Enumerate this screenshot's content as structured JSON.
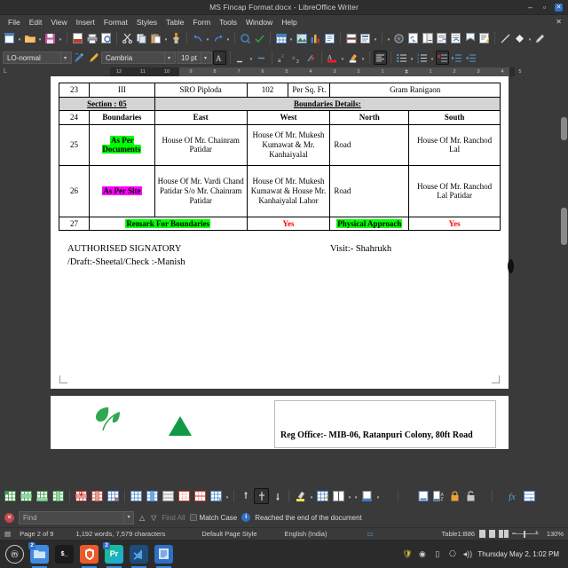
{
  "window": {
    "title": "MS Fincap Format.docx - LibreOffice Writer",
    "minimize": "–",
    "maximize": "▫",
    "close": "✕"
  },
  "menubar": {
    "items": [
      {
        "label": "File"
      },
      {
        "label": "Edit"
      },
      {
        "label": "View"
      },
      {
        "label": "Insert"
      },
      {
        "label": "Format"
      },
      {
        "label": "Styles"
      },
      {
        "label": "Table"
      },
      {
        "label": "Form"
      },
      {
        "label": "Tools"
      },
      {
        "label": "Window"
      },
      {
        "label": "Help"
      }
    ],
    "doc_close": "✕"
  },
  "standard_toolbar": {
    "items": [
      {
        "name": "new-icon",
        "glyph": "new"
      },
      {
        "name": "open-icon",
        "glyph": "open"
      },
      {
        "name": "save-icon",
        "glyph": "save"
      },
      {
        "name": "export-pdf-icon",
        "glyph": "pdf"
      },
      {
        "name": "print-icon",
        "glyph": "print"
      },
      {
        "name": "print-preview-icon",
        "glyph": "preview"
      },
      {
        "name": "cut-icon",
        "glyph": "cut"
      },
      {
        "name": "copy-icon",
        "glyph": "copy"
      },
      {
        "name": "paste-icon",
        "glyph": "paste"
      },
      {
        "name": "clone-formatting-icon",
        "glyph": "clone"
      },
      {
        "name": "undo-icon",
        "glyph": "undo"
      },
      {
        "name": "redo-icon",
        "glyph": "redo"
      },
      {
        "name": "find-replace-icon",
        "glyph": "find"
      },
      {
        "name": "spelling-icon",
        "glyph": "spell"
      },
      {
        "name": "insert-table-icon",
        "glyph": "table"
      },
      {
        "name": "insert-image-icon",
        "glyph": "image"
      },
      {
        "name": "insert-chart-icon",
        "glyph": "chart"
      },
      {
        "name": "insert-textbox-icon",
        "glyph": "textbox"
      },
      {
        "name": "page-break-icon",
        "glyph": "pagebreak"
      },
      {
        "name": "insert-field-icon",
        "glyph": "field"
      },
      {
        "name": "insert-special-character-icon",
        "glyph": "specialchar"
      },
      {
        "name": "insert-hyperlink-icon",
        "glyph": "link"
      },
      {
        "name": "insert-footnote-icon",
        "glyph": "footnote"
      },
      {
        "name": "insert-endnote-icon",
        "glyph": "endnote"
      },
      {
        "name": "bookmark-icon",
        "glyph": "bookmark"
      },
      {
        "name": "cross-reference-icon",
        "glyph": "xref"
      },
      {
        "name": "comment-icon",
        "glyph": "comment"
      },
      {
        "name": "track-changes-icon",
        "glyph": "track"
      },
      {
        "name": "line-icon",
        "glyph": "line"
      },
      {
        "name": "basic-shapes-icon",
        "glyph": "shapes"
      },
      {
        "name": "show-draw-functions-icon",
        "glyph": "draw"
      }
    ]
  },
  "formatting_toolbar": {
    "paragraph_style": "LO-normal",
    "font_name": "Cambria",
    "font_size": "10 pt",
    "dropdown_arrow": "▾",
    "items": [
      {
        "name": "update-style-icon"
      },
      {
        "name": "new-style-icon"
      },
      {
        "name": "bold-icon"
      },
      {
        "name": "italic-icon"
      },
      {
        "name": "underline-icon"
      },
      {
        "name": "strikethrough-icon"
      },
      {
        "name": "superscript-icon"
      },
      {
        "name": "subscript-icon"
      },
      {
        "name": "clear-formatting-icon"
      },
      {
        "name": "font-color-icon"
      },
      {
        "name": "highlight-color-icon"
      },
      {
        "name": "align-left-icon"
      },
      {
        "name": "align-center-icon"
      },
      {
        "name": "align-right-icon"
      },
      {
        "name": "justified-icon"
      },
      {
        "name": "unordered-list-icon"
      },
      {
        "name": "ordered-list-icon"
      },
      {
        "name": "no-list-icon"
      },
      {
        "name": "increase-indent-icon"
      },
      {
        "name": "decrease-indent-icon"
      }
    ]
  },
  "ruler": {
    "ticks": [
      "12",
      "11",
      "10",
      "9",
      "8",
      "7",
      "6",
      "5",
      "4",
      "3",
      "2",
      "1",
      "",
      "1",
      "2",
      "3",
      "4",
      "5"
    ]
  },
  "document": {
    "table": {
      "rows": [
        {
          "name": "row-23",
          "type": "data",
          "cells": [
            "23",
            "III",
            "SRO  Piploda",
            "102",
            "Per Sq. Ft.",
            "Gram Ranigaon"
          ]
        },
        {
          "name": "row-section-05",
          "type": "section",
          "cells": [
            "Section : 05",
            "Boundaries Details:"
          ]
        },
        {
          "name": "row-24",
          "type": "header",
          "cells": [
            "24",
            "Boundaries",
            "East",
            "West",
            "North",
            "South"
          ]
        },
        {
          "name": "row-25",
          "type": "data",
          "cells": [
            "25",
            "As Per Documents",
            "House Of Mr. Chainram Patidar",
            "House Of Mr. Mukesh Kumawat & Mr. Kanhaiyalal",
            "Road",
            "House Of Mr. Ranchod Lal"
          ]
        },
        {
          "name": "row-26",
          "type": "data",
          "cells": [
            "26",
            "As Per Site",
            "House Of Mr. Vardi Chand Patidar S/o Mr. Chainram Patidar",
            "House Of Mr. Mukesh Kumawat & House  Mr. Kanhaiyalal Lahor",
            "Road",
            "House Of Mr. Ranchod Lal Patidar"
          ]
        },
        {
          "name": "row-27",
          "type": "remark",
          "cells": [
            "27",
            "Remark For Boundaries",
            "Yes",
            "Physical Approach",
            "Yes"
          ]
        }
      ]
    },
    "signature": {
      "line1": "AUTHORISED SIGNATORY",
      "line2": "/Draft:-Sheetal/Check :-Manish",
      "visit": "Visit:- Shahrukh"
    },
    "page2": {
      "reg_office": "Reg Office:- MIB-06, Ratanpuri Colony, 80ft Road"
    }
  },
  "table_toolbar": {
    "items": [
      {
        "name": "insert-table-icon"
      },
      {
        "name": "insert-row-above-icon"
      },
      {
        "name": "insert-row-below-icon"
      },
      {
        "name": "insert-column-before-icon"
      },
      {
        "name": "delete-row-icon"
      },
      {
        "name": "delete-column-icon"
      },
      {
        "name": "delete-table-icon"
      },
      {
        "name": "select-table-icon"
      },
      {
        "name": "select-column-icon"
      },
      {
        "name": "select-row-icon"
      },
      {
        "name": "select-cell-icon"
      },
      {
        "name": "merge-cells-icon"
      },
      {
        "name": "split-cells-icon"
      },
      {
        "name": "optimize-size-icon"
      },
      {
        "name": "align-top-icon"
      },
      {
        "name": "center-vertically-icon"
      },
      {
        "name": "align-bottom-icon"
      },
      {
        "name": "borders-icon"
      },
      {
        "name": "border-style-icon"
      },
      {
        "name": "border-color-icon"
      },
      {
        "name": "table-properties-icon"
      },
      {
        "name": "background-color-icon"
      },
      {
        "name": "insert-caption-icon"
      },
      {
        "name": "sort-icon"
      },
      {
        "name": "protect-cells-icon"
      },
      {
        "name": "unprotect-cells-icon"
      },
      {
        "name": "sum-icon"
      },
      {
        "name": "number-format-icon"
      }
    ]
  },
  "findbar": {
    "close": "✕",
    "placeholder": "Find",
    "value": "",
    "dropdown_arrow": "▾",
    "find_prev": "△",
    "find_next": "▽",
    "find_all": "Find All",
    "match_case": "Match Case",
    "info_badge": "i",
    "status": "Reached the end of the document"
  },
  "statusbar": {
    "page": "Page 2 of 9",
    "words": "1,192 words, 7,579 characters",
    "page_style": "Default Page Style",
    "language": "English (India)",
    "selection_mode": "▭",
    "table_cell": "Table1:B86",
    "zoom": "130%",
    "zoom_minus": "–",
    "zoom_plus": "+"
  },
  "taskbar": {
    "menu_logo": "mint-menu-icon",
    "apps": [
      {
        "name": "files-icon",
        "label": "",
        "color": "#3f8ae0",
        "badge": "2"
      },
      {
        "name": "terminal-icon",
        "label": "$_",
        "color": "#1b1b1b",
        "badge": ""
      },
      {
        "name": "brave-browser-icon",
        "label": "",
        "color": "#eb5a2a",
        "badge": ""
      },
      {
        "name": "premiere-pro-icon",
        "label": "Pr",
        "color": "#22c55e",
        "badge": "2"
      },
      {
        "name": "vscode-icon",
        "label": "",
        "color": "#1f4b78",
        "badge": ""
      },
      {
        "name": "libreoffice-writer-icon",
        "label": "",
        "color": "#2f6fc4",
        "badge": ""
      }
    ],
    "tray": [
      {
        "name": "update-manager-icon",
        "glyph": "🛡"
      },
      {
        "name": "shield-icon",
        "glyph": "◉"
      },
      {
        "name": "battery-icon",
        "glyph": "▯"
      },
      {
        "name": "network-icon",
        "glyph": "⎔"
      },
      {
        "name": "volume-icon",
        "glyph": "◂))"
      }
    ],
    "clock": "Thursday May 2,  1:02 PM"
  },
  "colors": {
    "highlight_green": "#00ff00",
    "highlight_magenta": "#ff00ff",
    "red_text": "#ff0000",
    "section_gray": "#d4d4d4",
    "accent": "#2f6fc4"
  }
}
